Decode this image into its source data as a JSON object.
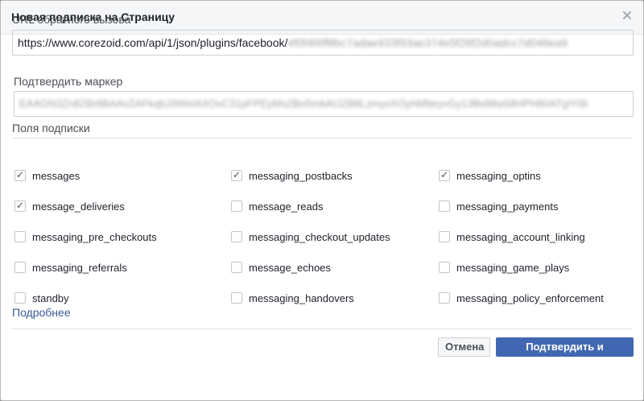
{
  "dialog": {
    "title": "Новая подписка на Страницу",
    "close_icon": "close-icon"
  },
  "url_field": {
    "label": "URL обратного вызова",
    "value_prefix": "https://www.corezoid.com/api/1/json/plugins/facebook/",
    "value_hidden": "4f0f4f4ff8bc7adae933f93ae374e5f28f2d0adcc7d046ea9"
  },
  "token_field": {
    "label": "Подтвердить маркер",
    "value_hidden": "EAAGN3Zn8ZBr8BAAvZAFkqbJ3WeIAXOvC31pFPEyMsZBo5mbAIJZB8LzmyxXOyhMfaryvGy13Bs88aS8HPH60ATgiY0k"
  },
  "subscription_fields": {
    "label": "Поля подписки",
    "items": [
      {
        "label": "messages",
        "checked": true
      },
      {
        "label": "messaging_postbacks",
        "checked": true
      },
      {
        "label": "messaging_optins",
        "checked": true
      },
      {
        "label": "message_deliveries",
        "checked": true
      },
      {
        "label": "message_reads",
        "checked": false
      },
      {
        "label": "messaging_payments",
        "checked": false
      },
      {
        "label": "messaging_pre_checkouts",
        "checked": false
      },
      {
        "label": "messaging_checkout_updates",
        "checked": false
      },
      {
        "label": "messaging_account_linking",
        "checked": false
      },
      {
        "label": "messaging_referrals",
        "checked": false
      },
      {
        "label": "message_echoes",
        "checked": false
      },
      {
        "label": "messaging_game_plays",
        "checked": false
      },
      {
        "label": "standby",
        "checked": false
      },
      {
        "label": "messaging_handovers",
        "checked": false
      },
      {
        "label": "messaging_policy_enforcement",
        "checked": false
      }
    ]
  },
  "more_link": "Подробнее",
  "buttons": {
    "cancel": "Отмена",
    "save": "Подтвердить и сохранить"
  },
  "colors": {
    "primary": "#4267b2",
    "link": "#385898",
    "header_bg": "#f5f6f7"
  }
}
